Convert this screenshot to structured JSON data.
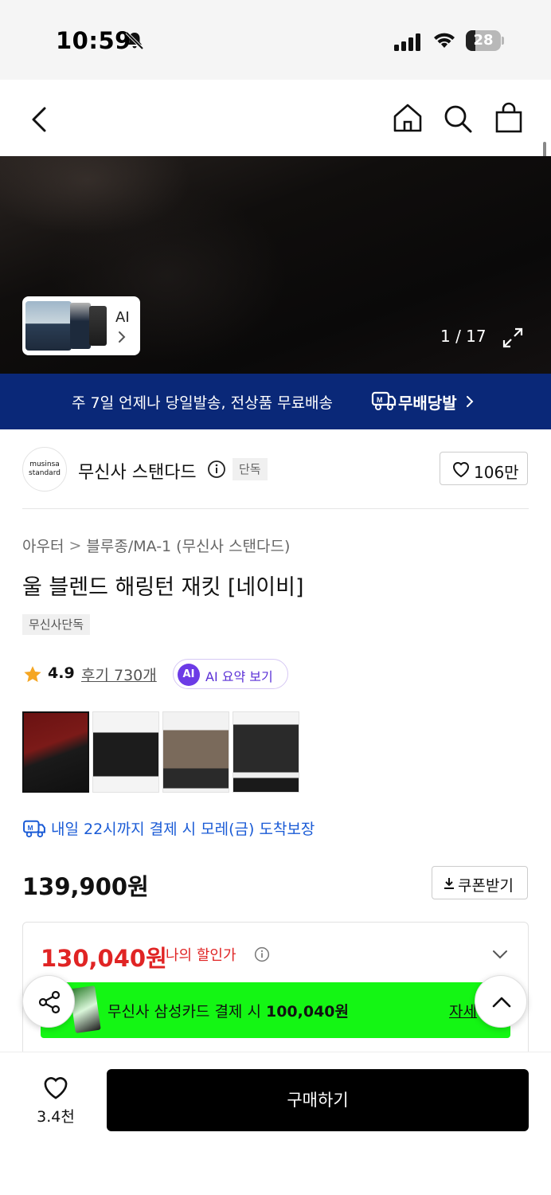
{
  "status": {
    "time": "10:59",
    "battery": "28",
    "battery_level": 0.28
  },
  "hero": {
    "ai_label": "AI",
    "counter": "1 / 17"
  },
  "banner": {
    "text": "주 7일 언제나 당일발송, 전상품 무료배송",
    "brand": "무배당발"
  },
  "brand": {
    "logo_line1": "musinsa",
    "logo_line2": "standard",
    "name": "무신사 스탠다드",
    "badge": "단독",
    "likes": "106만"
  },
  "breadcrumb": {
    "level1": "아우터",
    "separator": ">",
    "level2": "블루종/MA-1 (무신사 스탠다드)"
  },
  "product": {
    "title": "울 블렌드 해링턴 재킷 [네이비]",
    "tag": "무신사단독"
  },
  "rating": {
    "score": "4.9",
    "reviews": "후기 730개",
    "ai_badge": "AI",
    "ai_summary": "AI 요약 보기"
  },
  "delivery": {
    "text": "내일 22시까지 결제 시 모레(금) 도착보장"
  },
  "price": {
    "original": "139,900원",
    "coupon_label": "쿠폰받기"
  },
  "discount": {
    "sale_price": "130,040원",
    "label": "나의 할인가",
    "card_text": "무신사 삼성카드 결제 시",
    "card_price": "100,040원",
    "detail_label": "자세"
  },
  "bottom": {
    "wish_count": "3.4천",
    "buy_label": "구매하기"
  },
  "colors": {
    "banner": "#0a2878",
    "sale": "#e02424",
    "promo": "#14f614",
    "link": "#1a5bd6",
    "ai": "#6c3be6"
  }
}
